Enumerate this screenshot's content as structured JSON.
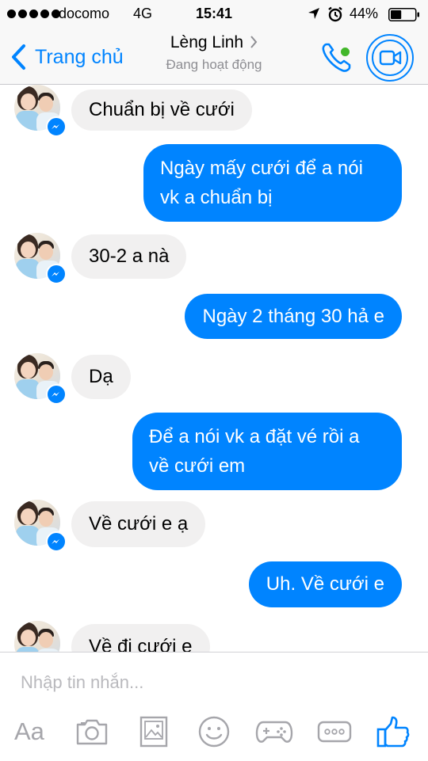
{
  "status_bar": {
    "carrier": "docomo",
    "network": "4G",
    "time": "15:41",
    "battery": "44%",
    "battery_level": 0.44
  },
  "nav": {
    "back_label": "Trang chủ",
    "contact_name": "Lèng Linh",
    "presence": "Đang hoạt động"
  },
  "colors": {
    "accent": "#0084ff",
    "incoming_bubble": "#f1f0f0",
    "online": "#42b72a"
  },
  "messages": [
    {
      "direction": "in",
      "text": "Chuẩn bị về cưới"
    },
    {
      "direction": "out",
      "lines": [
        "Ngày mấy cưới để a nói",
        "vk a chuẩn bị"
      ]
    },
    {
      "direction": "in",
      "text": "30-2 a nà"
    },
    {
      "direction": "out",
      "text": "Ngày 2 tháng 30 hả e"
    },
    {
      "direction": "in",
      "text": "Dạ"
    },
    {
      "direction": "out",
      "lines": [
        "Để a nói vk a đặt vé rồi a",
        "về cưới em"
      ]
    },
    {
      "direction": "in",
      "text": "Về cưới e ạ"
    },
    {
      "direction": "out",
      "text": "Uh. Về cưới e"
    },
    {
      "direction": "in",
      "text": "Về đi cưới e"
    }
  ],
  "composer": {
    "placeholder": "Nhập tin nhắn...",
    "aa_label": "Aa",
    "tools": [
      "text-style-icon",
      "camera-icon",
      "photo-gallery-icon",
      "sticker-smiley-icon",
      "game-controller-icon",
      "more-icon",
      "like-icon"
    ]
  }
}
